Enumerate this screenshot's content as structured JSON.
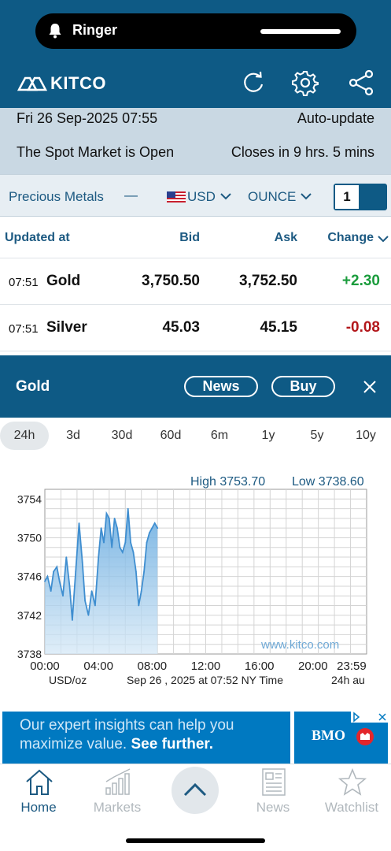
{
  "status": {
    "ringer_label": "Ringer"
  },
  "app": {
    "logo": "KITCO"
  },
  "info": {
    "datetime": "Fri 26 Sep-2025 07:55",
    "auto_update": "Auto-update",
    "market_status": "The Spot Market is Open",
    "closes_in": "Closes in 9 hrs. 5 mins"
  },
  "selectors": {
    "category": "Precious Metals",
    "collapse_symbol": "—",
    "currency": "USD",
    "unit": "OUNCE",
    "quantity": "1"
  },
  "table": {
    "headers": {
      "updated": "Updated at",
      "bid": "Bid",
      "ask": "Ask",
      "change": "Change"
    },
    "rows": [
      {
        "time": "07:51",
        "metal": "Gold",
        "bid": "3,750.50",
        "ask": "3,752.50",
        "change": "+2.30",
        "change_color": "#1a9c3c"
      },
      {
        "time": "07:51",
        "metal": "Silver",
        "bid": "45.03",
        "ask": "45.15",
        "change": "-0.08",
        "change_color": "#b3171b"
      }
    ]
  },
  "detail": {
    "title": "Gold",
    "news_button": "News",
    "buy_button": "Buy",
    "ranges": [
      "24h",
      "3d",
      "30d",
      "60d",
      "6m",
      "1y",
      "5y",
      "10y"
    ],
    "active_range": "24h"
  },
  "chart_data": {
    "type": "area",
    "high_label": "High 3753.70",
    "low_label": "Low 3738.60",
    "watermark": "www.kitco.com",
    "y_ticks": [
      "3754",
      "3750",
      "3746",
      "3742",
      "3738"
    ],
    "x_ticks": [
      "00:00",
      "04:00",
      "08:00",
      "12:00",
      "16:00",
      "20:00",
      "23:59"
    ],
    "unit_label": "USD/oz",
    "timestamp_label": "Sep 26 , 2025 at 07:52 NY Time",
    "span_label": "24h au",
    "ylim": [
      3738,
      3755
    ],
    "xlim_hours": [
      0,
      24
    ],
    "x_hours": [
      0.0,
      0.2,
      0.45,
      0.65,
      0.9,
      1.1,
      1.35,
      1.6,
      1.85,
      2.05,
      2.3,
      2.55,
      2.8,
      3.0,
      3.25,
      3.5,
      3.75,
      4.0,
      4.2,
      4.4,
      4.6,
      4.8,
      5.0,
      5.2,
      5.4,
      5.6,
      5.8,
      6.0,
      6.2,
      6.4,
      6.6,
      6.8,
      7.0,
      7.2,
      7.4,
      7.6,
      7.8,
      8.0,
      8.2,
      8.4
    ],
    "y_values": [
      3745.5,
      3746.0,
      3744.5,
      3746.5,
      3747.0,
      3745.5,
      3744.0,
      3748.0,
      3745.0,
      3741.5,
      3746.5,
      3751.5,
      3747.5,
      3743.5,
      3742.0,
      3744.5,
      3743.0,
      3748.0,
      3751.0,
      3749.5,
      3752.5,
      3752.0,
      3749.0,
      3752.0,
      3751.0,
      3749.0,
      3748.5,
      3749.5,
      3753.0,
      3749.5,
      3748.5,
      3746.5,
      3743.0,
      3744.5,
      3746.5,
      3749.5,
      3750.5,
      3751.0,
      3751.5,
      3751.0
    ]
  },
  "ad": {
    "line1": "Our expert insights can help you",
    "line2_plain": "maximize value.",
    "line2_strong": "See further.",
    "brand": "BMO"
  },
  "nav": {
    "home": "Home",
    "markets": "Markets",
    "news": "News",
    "watchlist": "Watchlist"
  },
  "colors": {
    "brand": "#0e5a85",
    "info_band": "#c9d8e3",
    "up": "#1a9c3c",
    "down": "#b3171b",
    "chart_line": "#3f8ed0",
    "ad": "#0079c1"
  }
}
